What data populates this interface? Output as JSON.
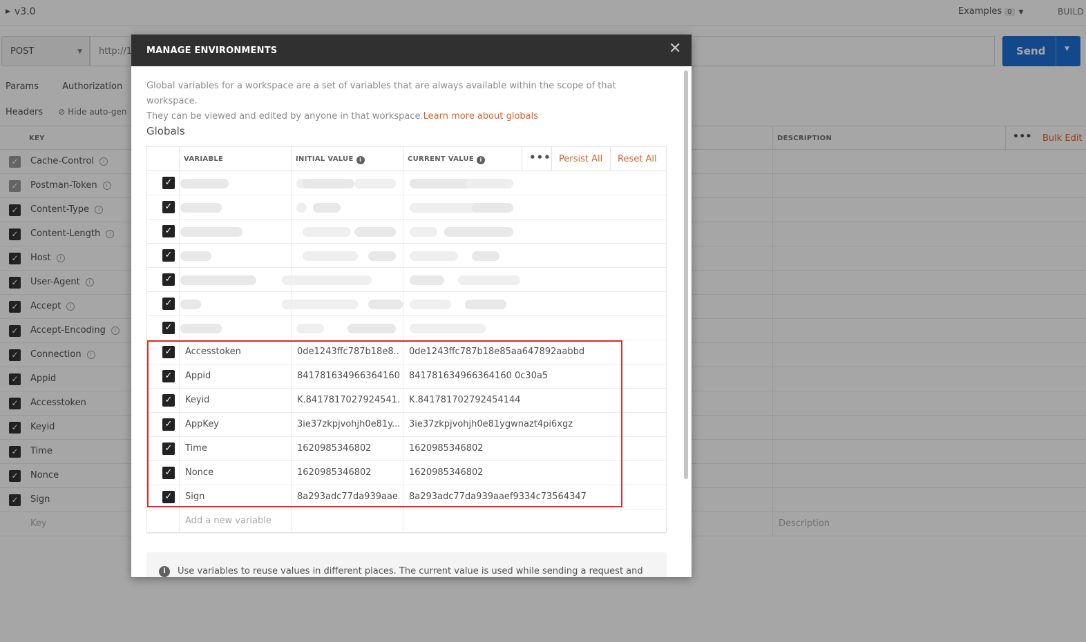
{
  "app": {
    "collection_title": "v3.0",
    "examples_label": "Examples",
    "examples_count": "0",
    "build_label": "BUILD",
    "method": "POST",
    "url": "http://1",
    "send_label": "Send",
    "tabs": [
      "Params",
      "Authorization"
    ],
    "headers_label": "Headers",
    "hide_auto_label": "Hide auto-gen",
    "table": {
      "key_header": "KEY",
      "description_header": "DESCRIPTION",
      "bulk_edit": "Bulk Edit",
      "rows": [
        {
          "key": "Cache-Control",
          "info": true,
          "checked_style": "grey"
        },
        {
          "key": "Postman-Token",
          "info": true,
          "checked_style": "grey"
        },
        {
          "key": "Content-Type",
          "info": true,
          "checked_style": "dark"
        },
        {
          "key": "Content-Length",
          "info": true,
          "checked_style": "dark"
        },
        {
          "key": "Host",
          "info": true,
          "checked_style": "dark"
        },
        {
          "key": "User-Agent",
          "info": true,
          "checked_style": "dark"
        },
        {
          "key": "Accept",
          "info": true,
          "checked_style": "dark"
        },
        {
          "key": "Accept-Encoding",
          "info": true,
          "checked_style": "dark"
        },
        {
          "key": "Connection",
          "info": true,
          "checked_style": "dark"
        },
        {
          "key": "Appid",
          "info": false,
          "checked_style": "dark"
        },
        {
          "key": "Accesstoken",
          "info": false,
          "checked_style": "dark"
        },
        {
          "key": "Keyid",
          "info": false,
          "checked_style": "dark"
        },
        {
          "key": "Time",
          "info": false,
          "checked_style": "dark"
        },
        {
          "key": "Nonce",
          "info": false,
          "checked_style": "dark"
        },
        {
          "key": "Sign",
          "info": false,
          "checked_style": "dark"
        }
      ],
      "key_placeholder": "Key",
      "description_placeholder": "Description"
    }
  },
  "modal": {
    "title": "MANAGE ENVIRONMENTS",
    "intro_line1": "Global variables for a workspace are a set of variables that are always available within the scope of that workspace.",
    "intro_line2": "They can be viewed and edited by anyone in that workspace.",
    "learn_more": "Learn more about globals",
    "section_title": "Globals",
    "columns": {
      "variable": "VARIABLE",
      "initial": "INITIAL VALUE",
      "current": "CURRENT VALUE"
    },
    "persist_all": "Persist All",
    "reset_all": "Reset All",
    "blurred_rows": 7,
    "variables": [
      {
        "name": "Accesstoken",
        "initial": "0de1243ffc787b18e8...",
        "current": "0de1243ffc787b18e85aa647892aabbd"
      },
      {
        "name": "Appid",
        "initial": "841781634966364160...",
        "current": "841781634966364160 0c30a5"
      },
      {
        "name": "Keyid",
        "initial": "K.8417817027924541...",
        "current": "K.841781702792454144"
      },
      {
        "name": "AppKey",
        "initial": "3ie37zkpjvohjh0e81y...",
        "current": "3ie37zkpjvohjh0e81ygwnazt4pi6xgz"
      },
      {
        "name": "Time",
        "initial": "1620985346802",
        "current": "1620985346802"
      },
      {
        "name": "Nonce",
        "initial": "1620985346802",
        "current": "1620985346802"
      },
      {
        "name": "Sign",
        "initial": "8a293adc77da939aae...",
        "current": "8a293adc77da939aaef9334c73564347"
      }
    ],
    "add_placeholder": "Add a new variable",
    "note": "Use variables to reuse values in different places. The current value is used while sending a request and"
  },
  "colors": {
    "accent": "#e0602a",
    "send": "#1e6fd6",
    "highlight": "#e02a2a",
    "modal_header": "#303030"
  }
}
